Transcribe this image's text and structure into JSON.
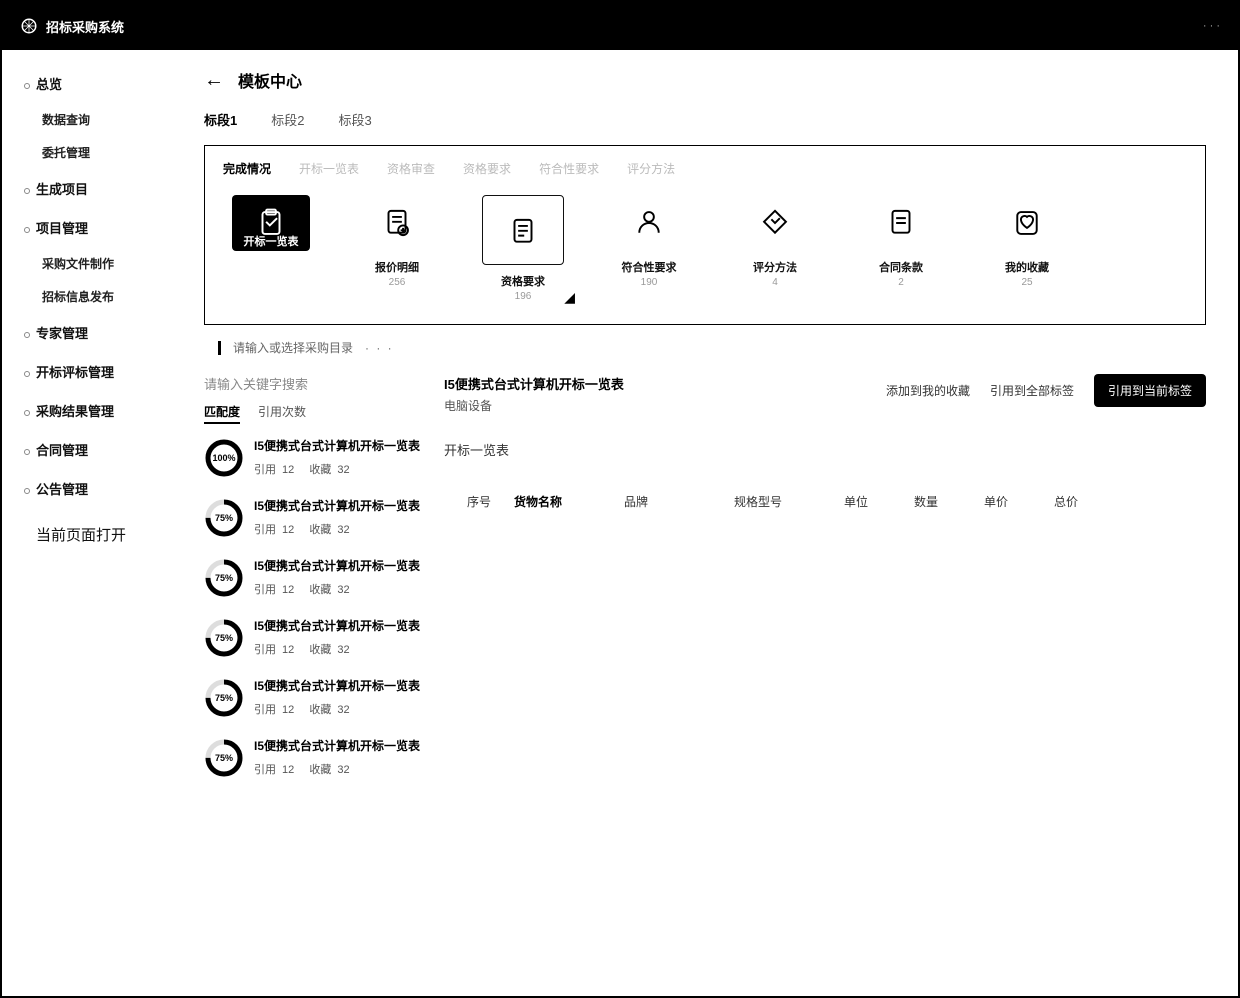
{
  "topbar": {
    "brand": "招标采购系统",
    "right": "· · ·"
  },
  "sidebar": {
    "items": [
      {
        "label": "总览",
        "kind": "item"
      },
      {
        "label": "数据查询",
        "kind": "sub"
      },
      {
        "label": "委托管理",
        "kind": "sub"
      },
      {
        "label": "生成项目",
        "kind": "item"
      },
      {
        "label": "项目管理",
        "kind": "item"
      },
      {
        "label": "采购文件制作",
        "kind": "sub"
      },
      {
        "label": "招标信息发布",
        "kind": "sub"
      },
      {
        "label": "专家管理",
        "kind": "item"
      },
      {
        "label": "开标评标管理",
        "kind": "item"
      },
      {
        "label": "采购结果管理",
        "kind": "item"
      },
      {
        "label": "合同管理",
        "kind": "item"
      },
      {
        "label": "公告管理",
        "kind": "item"
      }
    ],
    "open_hint": "当前页面打开"
  },
  "page": {
    "title": "模板中心"
  },
  "top_tabs": [
    {
      "label": "标段1",
      "active": true
    },
    {
      "label": "标段2",
      "active": false
    },
    {
      "label": "标段3",
      "active": false
    }
  ],
  "categories": [
    {
      "label": "完成情况",
      "active": true
    },
    {
      "label": "开标一览表",
      "active": false
    },
    {
      "label": "资格审查",
      "active": false
    },
    {
      "label": "资格要求",
      "active": false
    },
    {
      "label": "符合性要求",
      "active": false
    },
    {
      "label": "评分方法",
      "active": false
    }
  ],
  "tiles": [
    {
      "label": "开标一览表",
      "count": "",
      "state": "active",
      "icon": "clipboard"
    },
    {
      "label": "报价明细",
      "count": "256",
      "state": "",
      "icon": "doc-plus"
    },
    {
      "label": "资格要求",
      "count": "196",
      "state": "selected",
      "icon": "doc-lines"
    },
    {
      "label": "符合性要求",
      "count": "190",
      "state": "",
      "icon": "person"
    },
    {
      "label": "评分方法",
      "count": "4",
      "state": "",
      "icon": "diamond"
    },
    {
      "label": "合同条款",
      "count": "2",
      "state": "",
      "icon": "doc-eq"
    },
    {
      "label": "我的收藏",
      "count": "25",
      "state": "",
      "icon": "heart"
    }
  ],
  "catalog_hint": "请输入或选择采购目录",
  "search_placeholder": "请输入关键字搜索",
  "sort_tabs": [
    {
      "label": "匹配度",
      "active": true
    },
    {
      "label": "引用次数",
      "active": false
    }
  ],
  "results": [
    {
      "pct": 100,
      "title": "I5便携式台式计算机开标一览表",
      "ref_label": "引用",
      "ref": 12,
      "fav_label": "收藏",
      "fav": 32
    },
    {
      "pct": 75,
      "title": "I5便携式台式计算机开标一览表",
      "ref_label": "引用",
      "ref": 12,
      "fav_label": "收藏",
      "fav": 32
    },
    {
      "pct": 75,
      "title": "I5便携式台式计算机开标一览表",
      "ref_label": "引用",
      "ref": 12,
      "fav_label": "收藏",
      "fav": 32
    },
    {
      "pct": 75,
      "title": "I5便携式台式计算机开标一览表",
      "ref_label": "引用",
      "ref": 12,
      "fav_label": "收藏",
      "fav": 32
    },
    {
      "pct": 75,
      "title": "I5便携式台式计算机开标一览表",
      "ref_label": "引用",
      "ref": 12,
      "fav_label": "收藏",
      "fav": 32
    },
    {
      "pct": 75,
      "title": "I5便携式台式计算机开标一览表",
      "ref_label": "引用",
      "ref": 12,
      "fav_label": "收藏",
      "fav": 32
    }
  ],
  "detail": {
    "title": "I5便携式台式计算机开标一览表",
    "sub": "电脑设备",
    "actions": {
      "fav": "添加到我的收藏",
      "ref_all": "引用到全部标签",
      "ref_cur": "引用到当前标签"
    },
    "section": "开标一览表",
    "columns": [
      "序号",
      "货物名称",
      "品牌",
      "规格型号",
      "单位",
      "数量",
      "单价",
      "总价"
    ]
  }
}
